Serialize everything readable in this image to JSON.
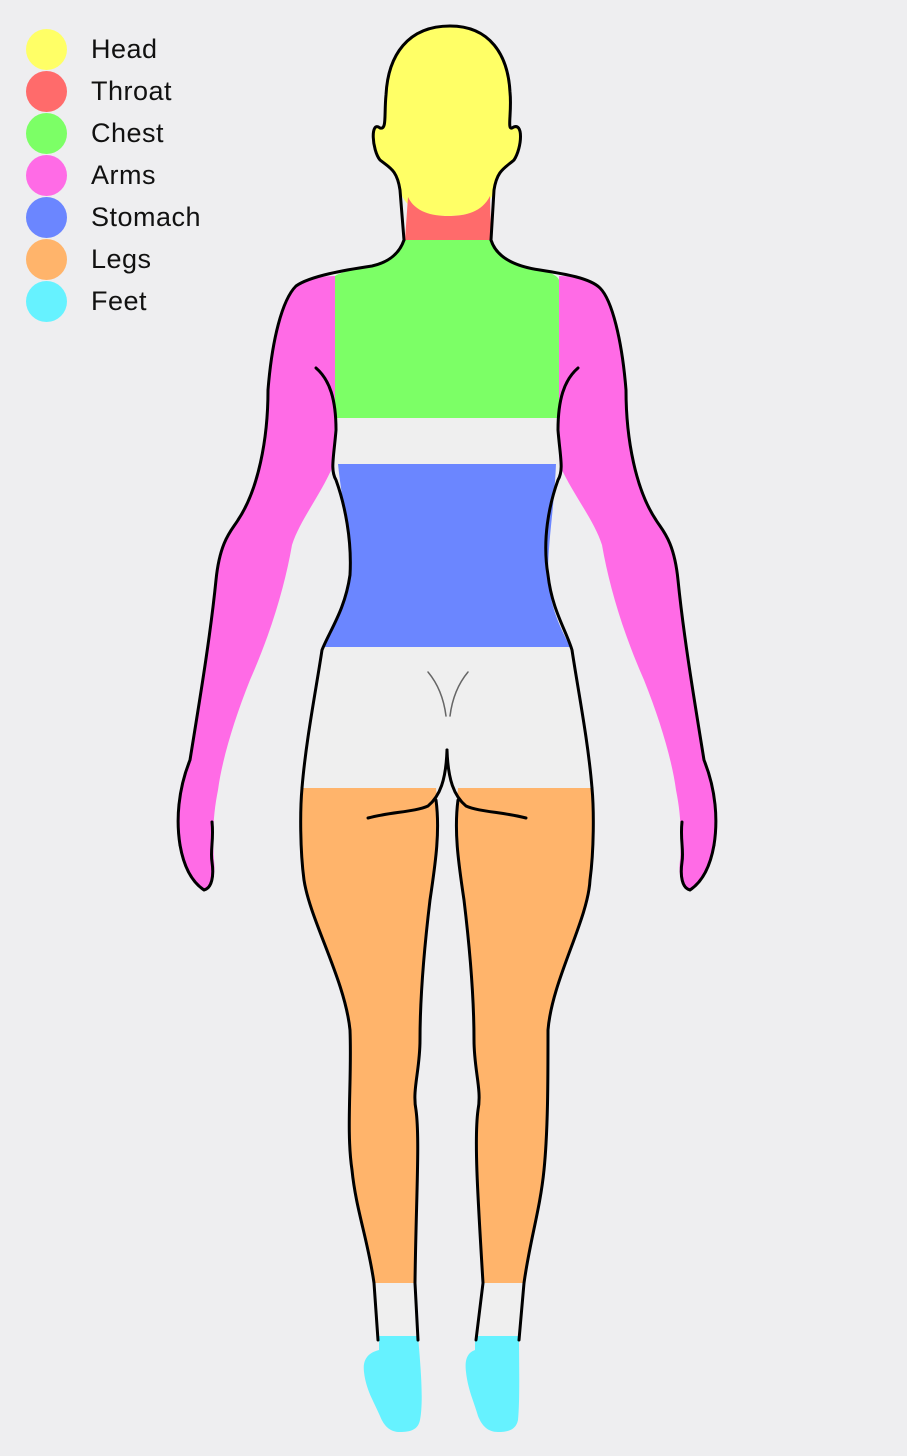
{
  "legend": [
    {
      "id": "head",
      "label": "Head",
      "color": "#ffff66"
    },
    {
      "id": "throat",
      "label": "Throat",
      "color": "#ff6b6b"
    },
    {
      "id": "chest",
      "label": "Chest",
      "color": "#7cff66"
    },
    {
      "id": "arms",
      "label": "Arms",
      "color": "#ff6be6"
    },
    {
      "id": "stomach",
      "label": "Stomach",
      "color": "#6b86ff"
    },
    {
      "id": "legs",
      "label": "Legs",
      "color": "#ffb46b"
    },
    {
      "id": "feet",
      "label": "Feet",
      "color": "#66f2ff"
    }
  ],
  "colors": {
    "background": "#eeeef0",
    "skin_unmarked": "#efefef",
    "outline": "#000000"
  }
}
